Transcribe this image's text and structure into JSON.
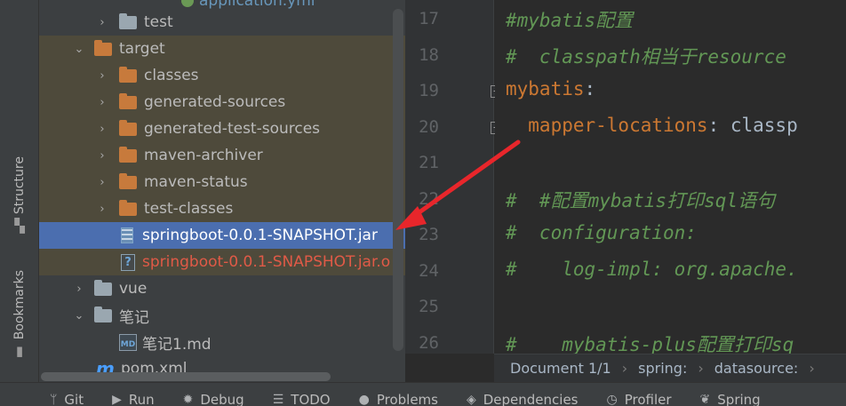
{
  "side_tabs": {
    "structure": "Structure",
    "bookmarks": "Bookmarks"
  },
  "tree": {
    "top_partial": "application.yml",
    "rows": [
      {
        "label": "test",
        "type": "folder-gray",
        "depth": 2,
        "arrow": "›"
      },
      {
        "label": "target",
        "type": "folder-orange",
        "depth": 1,
        "arrow": "⌄"
      },
      {
        "label": "classes",
        "type": "folder-orange",
        "depth": 2,
        "arrow": "›"
      },
      {
        "label": "generated-sources",
        "type": "folder-orange",
        "depth": 2,
        "arrow": "›"
      },
      {
        "label": "generated-test-sources",
        "type": "folder-orange",
        "depth": 2,
        "arrow": "›"
      },
      {
        "label": "maven-archiver",
        "type": "folder-orange",
        "depth": 2,
        "arrow": "›"
      },
      {
        "label": "maven-status",
        "type": "folder-orange",
        "depth": 2,
        "arrow": "›"
      },
      {
        "label": "test-classes",
        "type": "folder-orange",
        "depth": 2,
        "arrow": "›"
      },
      {
        "label": "springboot-0.0.1-SNAPSHOT.jar",
        "type": "jar",
        "depth": 2,
        "arrow": ""
      },
      {
        "label": "springboot-0.0.1-SNAPSHOT.jar.o",
        "type": "unknown",
        "depth": 2,
        "arrow": ""
      },
      {
        "label": "vue",
        "type": "folder-gray",
        "depth": 1,
        "arrow": "›"
      },
      {
        "label": "笔记",
        "type": "folder-gray",
        "depth": 1,
        "arrow": "⌄"
      },
      {
        "label": "笔记1.md",
        "type": "md",
        "depth": 2,
        "arrow": ""
      },
      {
        "label": "pom.xml",
        "type": "maven",
        "depth": 1,
        "arrow": ""
      }
    ],
    "icons": {
      "unknown": "?",
      "md": "MD",
      "maven": "m"
    }
  },
  "editor": {
    "line_numbers": [
      "17",
      "18",
      "19",
      "20",
      "21",
      "22",
      "23",
      "24",
      "25",
      "26"
    ],
    "lines": {
      "l17": "#mybatis配置",
      "l18": "#  classpath相当于resource",
      "l19_key": "mybatis",
      "l19_colon": ":",
      "l20_key": "  mapper-locations",
      "l20_rest": ": classp",
      "l22": "#  #配置mybatis打印sql语句",
      "l23": "#  configuration:",
      "l24": "#    log-impl: org.apache.",
      "l26": "#    mybatis-plus配置打印sq"
    },
    "fold_minus": "−"
  },
  "breadcrumb": {
    "doc": "Document 1/1",
    "item1": "spring:",
    "item2": "datasource:",
    "sep": "›"
  },
  "bottom_tabs": [
    {
      "icon": "ᛘ",
      "label": "Git"
    },
    {
      "icon": "▶",
      "label": "Run"
    },
    {
      "icon": "✹",
      "label": "Debug"
    },
    {
      "icon": "☰",
      "label": "TODO"
    },
    {
      "icon": "●",
      "label": "Problems"
    },
    {
      "icon": "◈",
      "label": "Dependencies"
    },
    {
      "icon": "◷",
      "label": "Profiler"
    },
    {
      "icon": "❦",
      "label": "Spring"
    }
  ],
  "colors": {
    "arrow": "#e8262b",
    "selected": "#4b6eaf",
    "excluded": "#4e4a3b"
  }
}
